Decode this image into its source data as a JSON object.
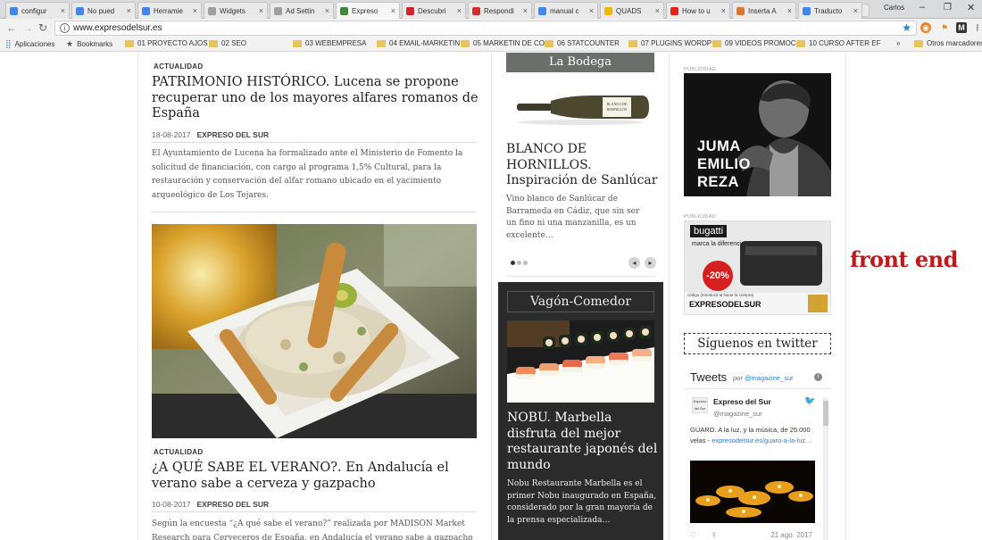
{
  "browser": {
    "tabs": [
      {
        "title": "configur",
        "icon": "google-icon",
        "color": "#4285f4"
      },
      {
        "title": "No pued",
        "icon": "google-icon",
        "color": "#4285f4"
      },
      {
        "title": "Herramie",
        "icon": "google-icon",
        "color": "#4285f4"
      },
      {
        "title": "Widgets",
        "icon": "page-icon",
        "color": "#9e9e9e"
      },
      {
        "title": "Ad Settin",
        "icon": "page-icon",
        "color": "#9e9e9e"
      },
      {
        "title": "Expreso",
        "icon": "site-icon",
        "color": "#3a8a3a"
      },
      {
        "title": "Descubri",
        "icon": "mail-icon",
        "color": "#d0242a"
      },
      {
        "title": "Respondi",
        "icon": "wp-icon",
        "color": "#d32f2f"
      },
      {
        "title": "manual c",
        "icon": "google-icon",
        "color": "#4285f4"
      },
      {
        "title": "QUADS",
        "icon": "plugin-icon",
        "color": "#f2b705"
      },
      {
        "title": "How to u",
        "icon": "youtube-icon",
        "color": "#e62117"
      },
      {
        "title": "Inserta A",
        "icon": "blogger-icon",
        "color": "#e2742b"
      },
      {
        "title": "Traducto",
        "icon": "translate-icon",
        "color": "#4285f4"
      }
    ],
    "user": "Carlos",
    "url": "www.expresodelsur.es",
    "bookmarks": [
      {
        "label": "Aplicaciones",
        "icon": "apps-icon"
      },
      {
        "label": "Bookmarks",
        "icon": "star-icon"
      },
      {
        "label": "01 PROYECTO AJOS",
        "icon": "folder-icon"
      },
      {
        "label": "02 SEO",
        "icon": "folder-icon"
      },
      {
        "label": "03 WEBEMPRESA",
        "icon": "folder-icon"
      },
      {
        "label": "04 EMAIL-MARKETIN",
        "icon": "folder-icon"
      },
      {
        "label": "05 MARKETIN DE CO",
        "icon": "folder-icon"
      },
      {
        "label": "06 STATCOUNTER",
        "icon": "folder-icon"
      },
      {
        "label": "07 PLUGINS WORDP",
        "icon": "folder-icon"
      },
      {
        "label": "09 VIDEOS PROMOC",
        "icon": "folder-icon"
      },
      {
        "label": "10 CURSO AFTER EF",
        "icon": "folder-icon"
      }
    ],
    "bookmarks_overflow": "»",
    "other_bookmarks": "Otros marcadores"
  },
  "articles": [
    {
      "category": "ACTUALIDAD",
      "title": "PATRIMONIO HISTÓRICO. Lucena se propone recuperar uno de los mayores alfares romanos de España",
      "date": "18-08-2017",
      "author": "EXPRESO DEL SUR",
      "excerpt": "El Ayuntamiento de Lucena ha formalizado ante el Ministerio de Fomento la solicitud de financiación, con cargo al programa 1,5% Cultural, para la restauración y conservación del alfar romano ubicado en el yacimiento arqueológico de Los Tejares."
    },
    {
      "category": "ACTUALIDAD",
      "title": "¿A QUÉ SABE EL VERANO?. En Andalucía el verano sabe a cerveza y gazpacho",
      "date": "10-08-2017",
      "author": "EXPRESO DEL SUR",
      "excerpt": "Según la encuesta “¿A qué sabe el verano?” realizada por MADISON Market Research para Cerveceros de España, en Andalucía el verano sabe a gazpacho y"
    }
  ],
  "bodega": {
    "header": "La Bodega",
    "title": "BLANCO DE HORNILLOS. Inspiración de Sanlúcar",
    "excerpt": "Vino blanco de Sanlúcar de Barrameda en Cádiz, que sin ser un fino ni una manzanilla, es un excelente…",
    "slider_dots": 3,
    "active_dot": 0
  },
  "vagon": {
    "header": "Vagón-Comedor",
    "title": "NOBU. Marbella disfruta del mejor restaurante japonés del mundo",
    "excerpt": "Nobu Restaurante Marbella es el primer Nobu inaugurado en España, considerado por la gran mayoría de la prensa especializada…"
  },
  "sidebar": {
    "ad_label_1": "PUBLICIDAD",
    "ad_juma_text": [
      "JUMA",
      "EMILIO",
      "REZA"
    ],
    "ad_label_2": "PUBLICIDAD",
    "ad_bugatti_brand": "bugatti",
    "ad_bugatti_tagline": "marca la diferencia",
    "ad_bugatti_discount": "-20%",
    "ad_bugatti_code_note": "código (introducir al hacer la compra)",
    "ad_bugatti_code": "EXPRESODELSUR",
    "follow_title": "Síguenos en twitter"
  },
  "overlay_text": "front end",
  "twitter": {
    "header": "Tweets",
    "by": "por",
    "handle_link": "@magazine_sur",
    "account_name": "Expreso del Sur",
    "account_handle": "@magazine_sur",
    "avatar_text": "Expreso del Sur",
    "tweet_text": "GUARO. A la luz, y la música, de 25.000 velas -",
    "tweet_link": "expresodelsur.es/guaro-a-la-luz…",
    "tweet_date": "21 ago. 2017"
  }
}
